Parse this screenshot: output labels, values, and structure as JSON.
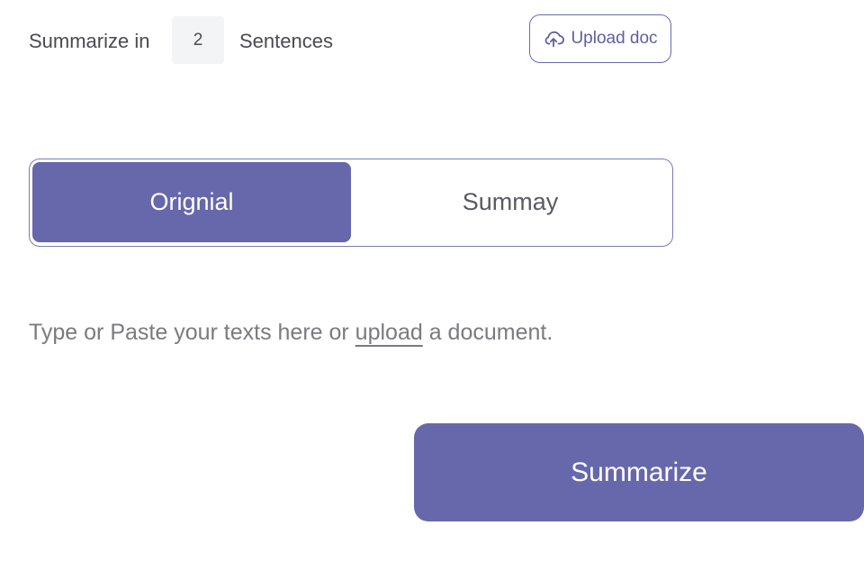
{
  "header": {
    "summarize_prefix": "Summarize in",
    "sentence_count": "2",
    "summarize_suffix": "Sentences",
    "upload_button_label": "Upload doc",
    "upload_icon": "cloud-upload-icon"
  },
  "tabs": [
    {
      "label": "Orignial",
      "active": true
    },
    {
      "label": "Summay",
      "active": false
    }
  ],
  "input": {
    "placeholder_before": "Type or Paste your texts here or ",
    "upload_link": "upload",
    "placeholder_after": " a document."
  },
  "actions": {
    "summarize_label": "Summarize"
  },
  "colors": {
    "accent": "#6767ab",
    "text": "#4a4a52",
    "muted_text": "#7a7a82"
  }
}
